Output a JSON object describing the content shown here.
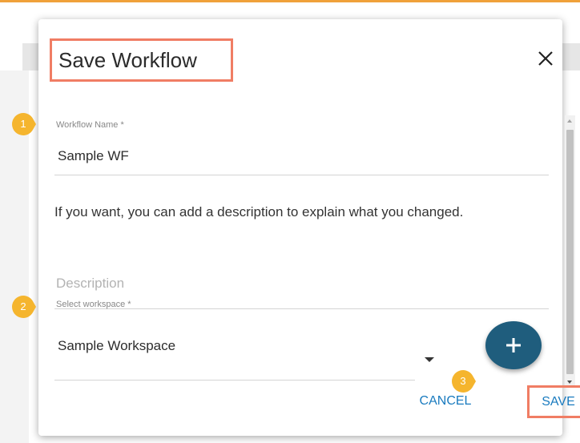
{
  "dialog": {
    "title": "Save Workflow",
    "close_icon": "close-icon"
  },
  "fields": {
    "workflow_name": {
      "label": "Workflow Name *",
      "value": "Sample WF"
    },
    "help_text": "If you want, you can add a description to explain what you changed.",
    "description": {
      "placeholder": "Description",
      "value": ""
    },
    "workspace": {
      "label": "Select workspace *",
      "value": "Sample Workspace"
    }
  },
  "actions": {
    "add_icon": "plus-icon",
    "cancel_label": "CANCEL",
    "save_label": "SAVE"
  },
  "callouts": [
    "1",
    "2",
    "3"
  ],
  "colors": {
    "accent": "#f0a13a",
    "highlight_box": "#f07d64",
    "callout": "#f5b52e",
    "fab": "#1f5d7d",
    "link": "#1a7bbf"
  }
}
